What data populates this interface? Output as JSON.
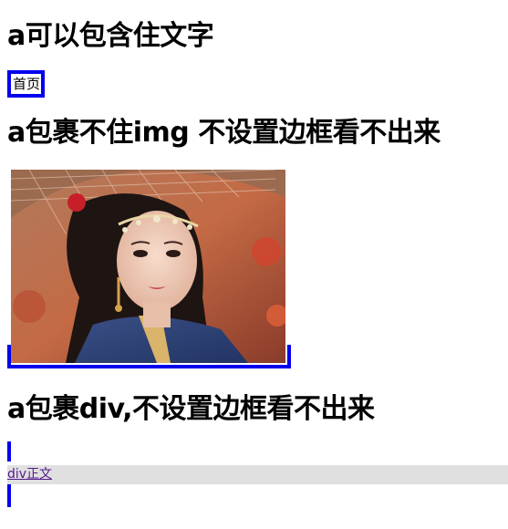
{
  "headings": {
    "h1": "a可以包含住文字",
    "h2": "a包裹不住img 不设置边框看不出来",
    "h3": "a包裹div,不设置边框看不出来"
  },
  "links": {
    "home_text": "首页",
    "div_text": "div正文"
  },
  "image": {
    "description_icon": "portrait-photo"
  },
  "colors": {
    "link_border": "#0000ee",
    "div_background": "#e0e0e0",
    "visited_link": "#551a8b"
  }
}
